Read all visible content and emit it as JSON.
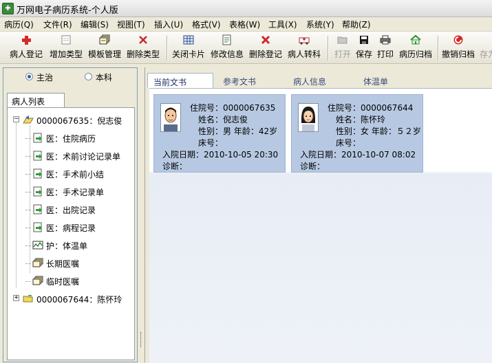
{
  "window": {
    "title": "万网电子病历系统-个人版"
  },
  "menu": [
    "病历(Q)",
    "文件(R)",
    "编辑(S)",
    "视图(T)",
    "插入(U)",
    "格式(V)",
    "表格(W)",
    "工具(X)",
    "系统(Y)",
    "帮助(Z)"
  ],
  "toolbar": {
    "register": "病人登记",
    "add_type": "增加类型",
    "template_manage": "模板管理",
    "delete_type": "删除类型",
    "close_card": "关闭卡片",
    "modify_info": "修改信息",
    "delete_register": "删除登记",
    "transfer": "病人转科",
    "open": "打开",
    "save": "保存",
    "print": "打印",
    "archive": "病历归档",
    "cancel_archive": "撤销归档",
    "save_as": "存为"
  },
  "left_panel": {
    "radio_main": "主治",
    "radio_dept": "本科",
    "list_tab": "病人列表",
    "tree": [
      {
        "label": "0000067635：倪志俊",
        "level": 0,
        "expander": "−"
      },
      {
        "label": "医：住院病历",
        "level": 1
      },
      {
        "label": "医：术前讨论记录单",
        "level": 1
      },
      {
        "label": "医：手术前小结",
        "level": 1
      },
      {
        "label": "医：手术记录单",
        "level": 1
      },
      {
        "label": "医：出院记录",
        "level": 1
      },
      {
        "label": "医：病程记录",
        "level": 1
      },
      {
        "label": "护：体温单",
        "level": 1
      },
      {
        "label": "长期医嘱",
        "level": 1
      },
      {
        "label": "临时医嘱",
        "level": 1
      },
      {
        "label": "0000067644：陈怀玲",
        "level": 0,
        "expander": "+"
      }
    ]
  },
  "doc_tabs": [
    "当前文书",
    "参考文书",
    "病人信息",
    "体温单"
  ],
  "patients": [
    {
      "id_label": "住院号：0000067635",
      "name_label": "姓名：倪志俊",
      "sex_age_label": "性别：男  年龄：42岁",
      "bed_label": "床号：",
      "admit_label": "入院日期：2010-10-05 20:30",
      "diag_label": "诊断："
    },
    {
      "id_label": "住院号：0000067644",
      "name_label": "姓名：陈怀玲",
      "sex_age_label": "性别：女  年龄：５２岁",
      "bed_label": "床号：",
      "admit_label": "入院日期：2010-10-07 08:02",
      "diag_label": "诊断："
    }
  ],
  "colors": {
    "card_bg": "#b7c9e2",
    "accent_red": "#c8202a",
    "accent_green": "#2f8f2f"
  }
}
